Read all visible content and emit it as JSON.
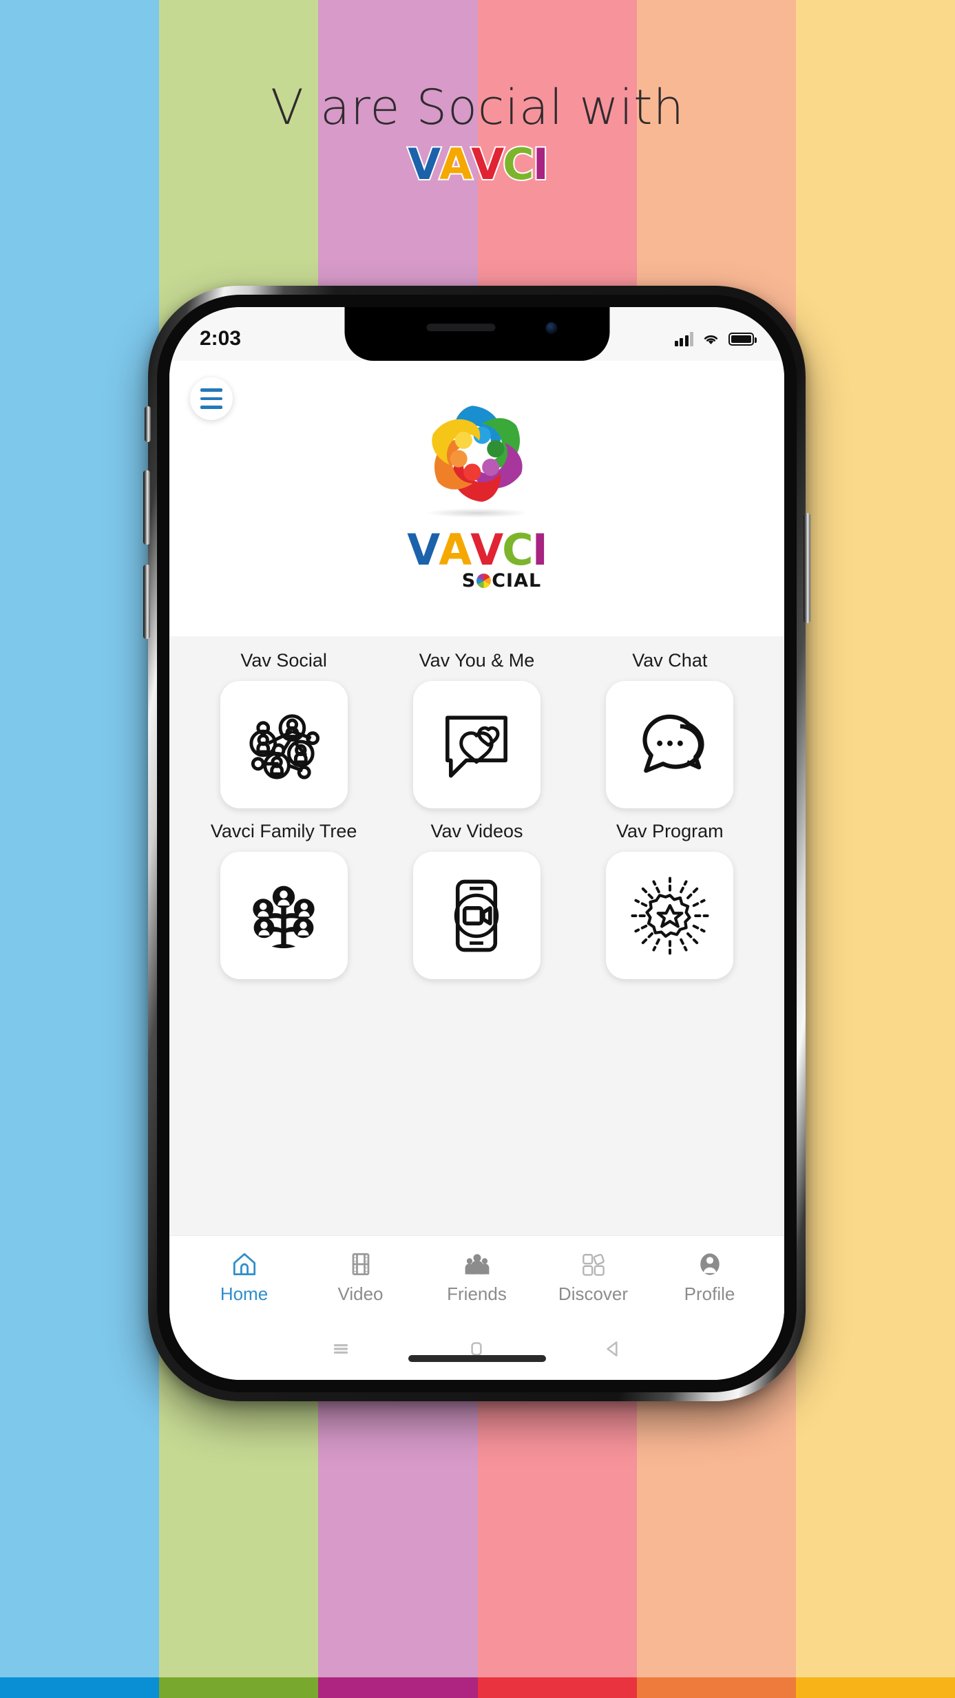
{
  "background": {
    "stripes": [
      "#7ec8ec",
      "#c6d993",
      "#d79ac9",
      "#f7939b",
      "#f9b894",
      "#fbd98a"
    ],
    "bottom_band": [
      "#0a8fd4",
      "#79a82e",
      "#ad2580",
      "#e9333f",
      "#ee7b3c",
      "#f7b318"
    ]
  },
  "poster": {
    "headline": "V are Social with",
    "wordmark": [
      {
        "char": "V",
        "color": "#1b62ab"
      },
      {
        "char": "A",
        "color": "#f5a800"
      },
      {
        "char": "V",
        "color": "#e02434"
      },
      {
        "char": "C",
        "color": "#7cb52c"
      },
      {
        "char": "I",
        "color": "#a82382"
      }
    ]
  },
  "phone": {
    "statusbar": {
      "time": "2:03",
      "signal_icon": "cellular-signal-icon",
      "wifi_icon": "wifi-icon",
      "battery_icon": "battery-full-icon"
    },
    "header": {
      "menu_icon": "hamburger-menu-icon",
      "menu_color": "#2379b9"
    },
    "hero": {
      "logo_icon": "vavci-star-people-logo",
      "star_colors": [
        "#1a8fd0",
        "#3aa93a",
        "#a8379d",
        "#e0262c",
        "#f08028",
        "#f5c518"
      ],
      "wordmark": [
        {
          "char": "V",
          "color": "#1b62ab"
        },
        {
          "char": "A",
          "color": "#f5a800"
        },
        {
          "char": "V",
          "color": "#e02434"
        },
        {
          "char": "C",
          "color": "#7cb52c"
        },
        {
          "char": "I",
          "color": "#a82382"
        }
      ],
      "sub_prefix": "S",
      "sub_suffix": "CIAL"
    },
    "tiles": [
      [
        {
          "label": "Vav Social",
          "icon": "social-network-icon"
        },
        {
          "label": "Vav You & Me",
          "icon": "chat-hearts-icon"
        },
        {
          "label": "Vav Chat",
          "icon": "chat-bubbles-icon"
        }
      ],
      [
        {
          "label": "Vavci Family Tree",
          "icon": "family-tree-icon"
        },
        {
          "label": "Vav Videos",
          "icon": "mobile-video-icon"
        },
        {
          "label": "Vav Program",
          "icon": "radiant-star-badge-icon"
        }
      ]
    ],
    "bottom_nav": [
      {
        "label": "Home",
        "icon": "home-icon",
        "active": true
      },
      {
        "label": "Video",
        "icon": "film-strip-icon",
        "active": false
      },
      {
        "label": "Friends",
        "icon": "friends-group-icon",
        "active": false
      },
      {
        "label": "Discover",
        "icon": "discover-shapes-icon",
        "active": false
      },
      {
        "label": "Profile",
        "icon": "profile-avatar-icon",
        "active": false
      }
    ],
    "soft_nav": [
      {
        "icon": "android-recents-icon"
      },
      {
        "icon": "android-home-icon"
      },
      {
        "icon": "android-back-icon"
      }
    ],
    "accent_color": "#2e8ecb"
  }
}
